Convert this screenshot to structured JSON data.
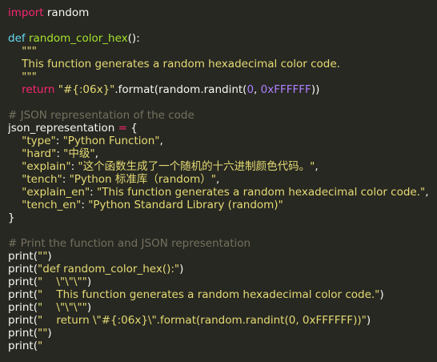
{
  "editor": {
    "colors": {
      "background": "#272822",
      "text": "#f8f8f2",
      "keyword": "#f92672",
      "def": "#66d9ef",
      "function": "#a6e22e",
      "string": "#e6db74",
      "number": "#ae81ff",
      "comment": "#75715e"
    },
    "lines": [
      [
        {
          "t": "kw",
          "v": "import"
        },
        {
          "t": "txt",
          "v": " random"
        }
      ],
      [],
      [
        {
          "t": "def",
          "v": "def"
        },
        {
          "t": "txt",
          "v": " "
        },
        {
          "t": "fn",
          "v": "random_color_hex"
        },
        {
          "t": "txt",
          "v": "():"
        }
      ],
      [
        {
          "t": "str",
          "v": "    \"\"\""
        }
      ],
      [
        {
          "t": "str",
          "v": "    This function generates a random hexadecimal color code."
        }
      ],
      [
        {
          "t": "str",
          "v": "    \"\"\""
        }
      ],
      [
        {
          "t": "txt",
          "v": "    "
        },
        {
          "t": "kw",
          "v": "return"
        },
        {
          "t": "txt",
          "v": " "
        },
        {
          "t": "str",
          "v": "\"#{:06x}\""
        },
        {
          "t": "txt",
          "v": ".format(random.randint("
        },
        {
          "t": "num",
          "v": "0"
        },
        {
          "t": "txt",
          "v": ", "
        },
        {
          "t": "num",
          "v": "0xFFFFFF"
        },
        {
          "t": "txt",
          "v": "))"
        }
      ],
      [],
      [
        {
          "t": "cmt",
          "v": "# JSON representation of the code"
        }
      ],
      [
        {
          "t": "txt",
          "v": "json_representation "
        },
        {
          "t": "op",
          "v": "="
        },
        {
          "t": "txt",
          "v": " {"
        }
      ],
      [
        {
          "t": "txt",
          "v": "    "
        },
        {
          "t": "str",
          "v": "\"type\""
        },
        {
          "t": "txt",
          "v": ": "
        },
        {
          "t": "str",
          "v": "\"Python Function\""
        },
        {
          "t": "txt",
          "v": ","
        }
      ],
      [
        {
          "t": "txt",
          "v": "    "
        },
        {
          "t": "str",
          "v": "\"hard\""
        },
        {
          "t": "txt",
          "v": ": "
        },
        {
          "t": "str",
          "v": "\"中级\""
        },
        {
          "t": "txt",
          "v": ","
        }
      ],
      [
        {
          "t": "txt",
          "v": "    "
        },
        {
          "t": "str",
          "v": "\"explain\""
        },
        {
          "t": "txt",
          "v": ": "
        },
        {
          "t": "str",
          "v": "\"这个函数生成了一个随机的十六进制颜色代码。\""
        },
        {
          "t": "txt",
          "v": ","
        }
      ],
      [
        {
          "t": "txt",
          "v": "    "
        },
        {
          "t": "str",
          "v": "\"tench\""
        },
        {
          "t": "txt",
          "v": ": "
        },
        {
          "t": "str",
          "v": "\"Python 标准库（random）\""
        },
        {
          "t": "txt",
          "v": ","
        }
      ],
      [
        {
          "t": "txt",
          "v": "    "
        },
        {
          "t": "str",
          "v": "\"explain_en\""
        },
        {
          "t": "txt",
          "v": ": "
        },
        {
          "t": "str",
          "v": "\"This function generates a random hexadecimal color code.\""
        },
        {
          "t": "txt",
          "v": ","
        }
      ],
      [
        {
          "t": "txt",
          "v": "    "
        },
        {
          "t": "str",
          "v": "\"tench_en\""
        },
        {
          "t": "txt",
          "v": ": "
        },
        {
          "t": "str",
          "v": "\"Python Standard Library (random)\""
        }
      ],
      [
        {
          "t": "txt",
          "v": "}"
        }
      ],
      [],
      [
        {
          "t": "cmt",
          "v": "# Print the function and JSON representation"
        }
      ],
      [
        {
          "t": "txt",
          "v": "print("
        },
        {
          "t": "str",
          "v": "\"\""
        },
        {
          "t": "txt",
          "v": ")"
        }
      ],
      [
        {
          "t": "txt",
          "v": "print("
        },
        {
          "t": "str",
          "v": "\"def random_color_hex():\""
        },
        {
          "t": "txt",
          "v": ")"
        }
      ],
      [
        {
          "t": "txt",
          "v": "print("
        },
        {
          "t": "str",
          "v": "\"    \\\"\\\"\\\"\""
        },
        {
          "t": "txt",
          "v": ")"
        }
      ],
      [
        {
          "t": "txt",
          "v": "print("
        },
        {
          "t": "str",
          "v": "\"    This function generates a random hexadecimal color code.\""
        },
        {
          "t": "txt",
          "v": ")"
        }
      ],
      [
        {
          "t": "txt",
          "v": "print("
        },
        {
          "t": "str",
          "v": "\"    \\\"\\\"\\\"\""
        },
        {
          "t": "txt",
          "v": ")"
        }
      ],
      [
        {
          "t": "txt",
          "v": "print("
        },
        {
          "t": "str",
          "v": "\"    return \\\"#{:06x}\\\".format(random.randint(0, 0xFFFFFF))\""
        },
        {
          "t": "txt",
          "v": ")"
        }
      ],
      [
        {
          "t": "txt",
          "v": "print("
        },
        {
          "t": "str",
          "v": "\"\""
        },
        {
          "t": "txt",
          "v": ")"
        }
      ],
      [
        {
          "t": "txt",
          "v": "print("
        },
        {
          "t": "str",
          "v": "\""
        }
      ]
    ]
  }
}
